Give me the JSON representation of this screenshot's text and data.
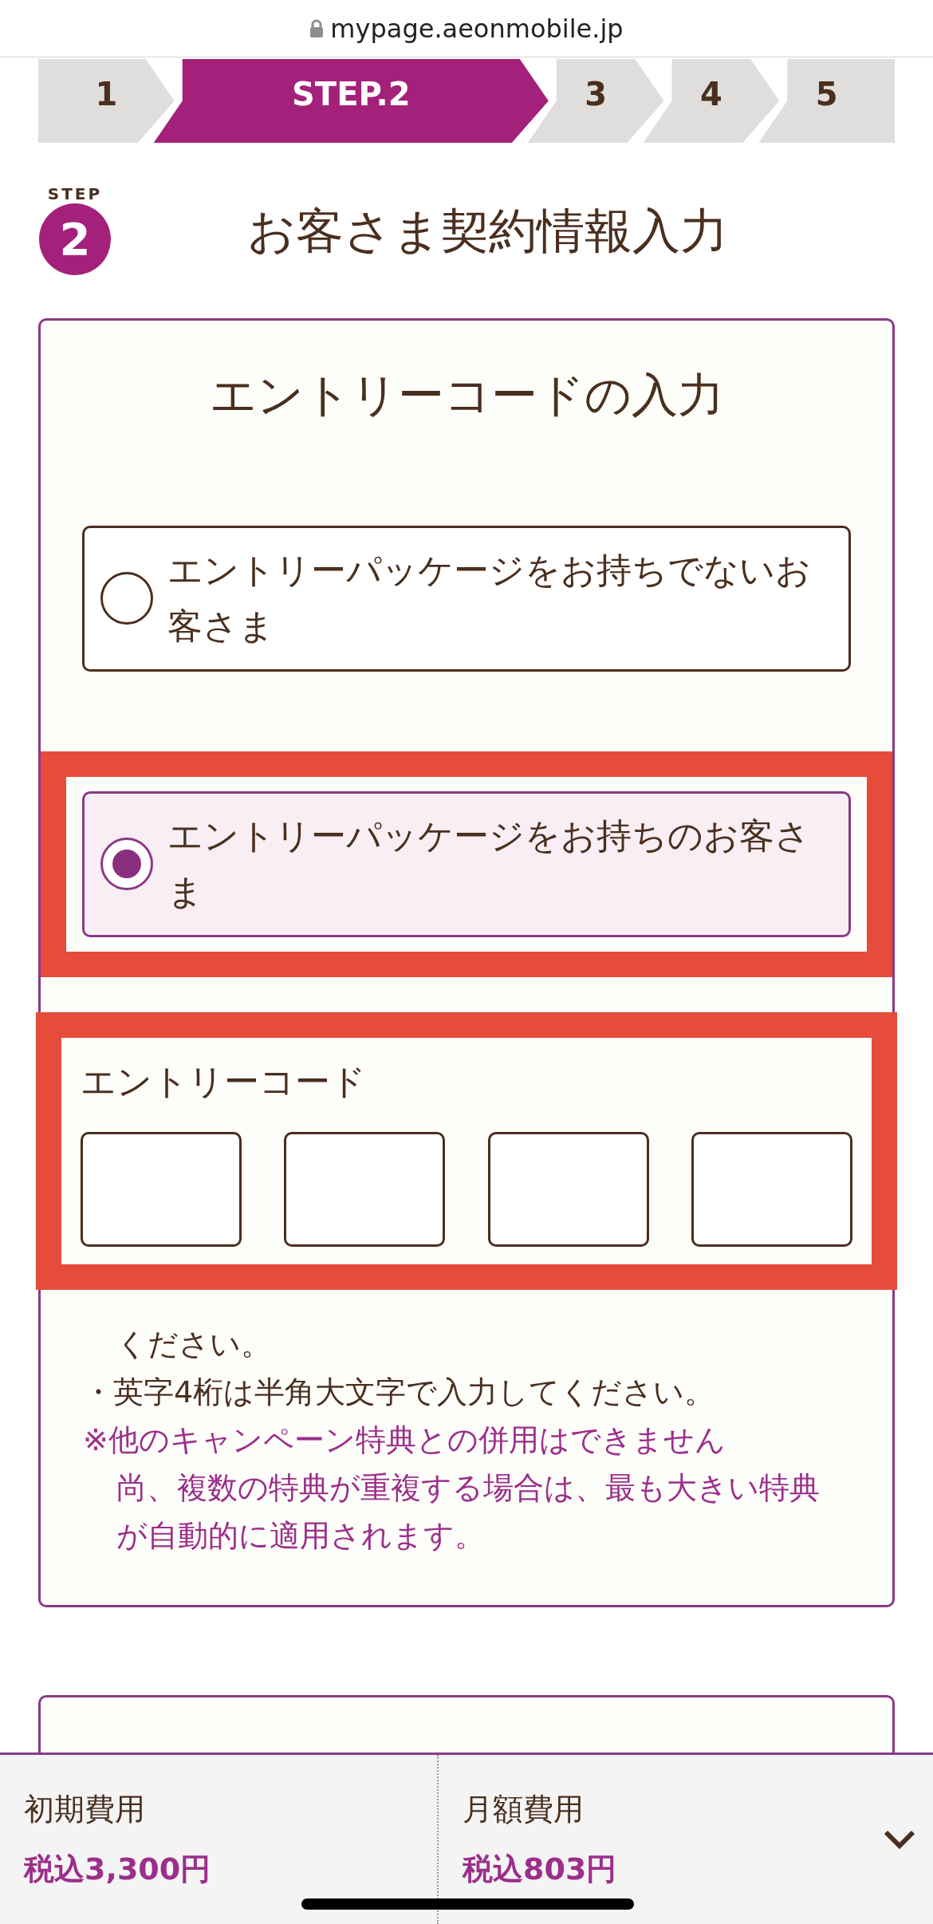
{
  "browser": {
    "url": "mypage.aeonmobile.jp"
  },
  "steps": [
    {
      "label": "1",
      "selected": false
    },
    {
      "label": "STEP.2",
      "selected": true
    },
    {
      "label": "3",
      "selected": false
    },
    {
      "label": "4",
      "selected": false
    },
    {
      "label": "5",
      "selected": false
    }
  ],
  "heading": {
    "badge_caption": "STEP",
    "badge_number": "2",
    "title": "お客さま契約情報入力"
  },
  "entry_card": {
    "title": "エントリーコードの入力",
    "options": [
      {
        "label": "エントリーパッケージをお持ちでないお客さま",
        "selected": false,
        "highlighted": false
      },
      {
        "label": "エントリーパッケージをお持ちのお客さま",
        "selected": true,
        "highlighted": true
      }
    ],
    "code": {
      "label": "エントリーコード",
      "highlighted": true,
      "fields": [
        {
          "kind": "text"
        },
        {
          "kind": "text"
        },
        {
          "kind": "text"
        },
        {
          "kind": "text"
        }
      ]
    },
    "notes": [
      {
        "kind": "continuation",
        "text": "ください。"
      },
      {
        "kind": "bullet",
        "text": "・英字4桁は半角大文字で入力してください。"
      },
      {
        "kind": "caution",
        "text": "※他のキャンペーン特典との併用はできません"
      },
      {
        "kind": "caution_continued",
        "text": "尚、複数の特典が重複する場合は、最も大きい特典が自動的に適用されます。"
      }
    ]
  },
  "summary_bar": {
    "items": [
      {
        "label": "初期費用",
        "value": "税込3,300円"
      },
      {
        "label": "月額費用",
        "value": "税込803円"
      }
    ],
    "expanded": false
  }
}
